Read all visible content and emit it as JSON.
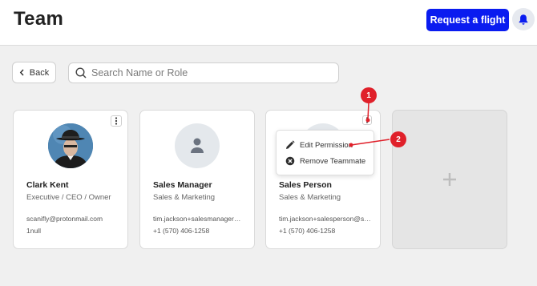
{
  "header": {
    "title": "Team",
    "request_flight_label": "Request a flight",
    "notifications_icon": "bell-icon"
  },
  "toolbar": {
    "back_label": "Back",
    "search_placeholder": "Search Name or Role"
  },
  "members": [
    {
      "name": "Clark Kent",
      "role": "Executive / CEO / Owner",
      "email": "scanifly@protonmail.com",
      "phone": "1null",
      "avatar": "photo"
    },
    {
      "name": "Sales Manager",
      "role": "Sales & Marketing",
      "email": "tim.jackson+salesmanager@scanifly.com",
      "phone": "+1 (570) 406-1258",
      "avatar": "user-placeholder-icon"
    },
    {
      "name": "Sales Person",
      "role": "Sales & Marketing",
      "email": "tim.jackson+salesperson@scanifly.com",
      "phone": "+1 (570) 406-1258",
      "avatar": "user-placeholder-icon"
    }
  ],
  "add_card": {
    "icon": "plus-icon"
  },
  "context_menu": {
    "items": [
      {
        "label": "Edit Permission",
        "icon": "pencil-icon"
      },
      {
        "label": "Remove Teammate",
        "icon": "remove-circle-icon"
      }
    ]
  },
  "annotations": {
    "marker_1": "1",
    "marker_2": "2"
  },
  "colors": {
    "primary": "#0a1cf0",
    "marker": "#e0202a",
    "background": "#f0f0f0"
  }
}
